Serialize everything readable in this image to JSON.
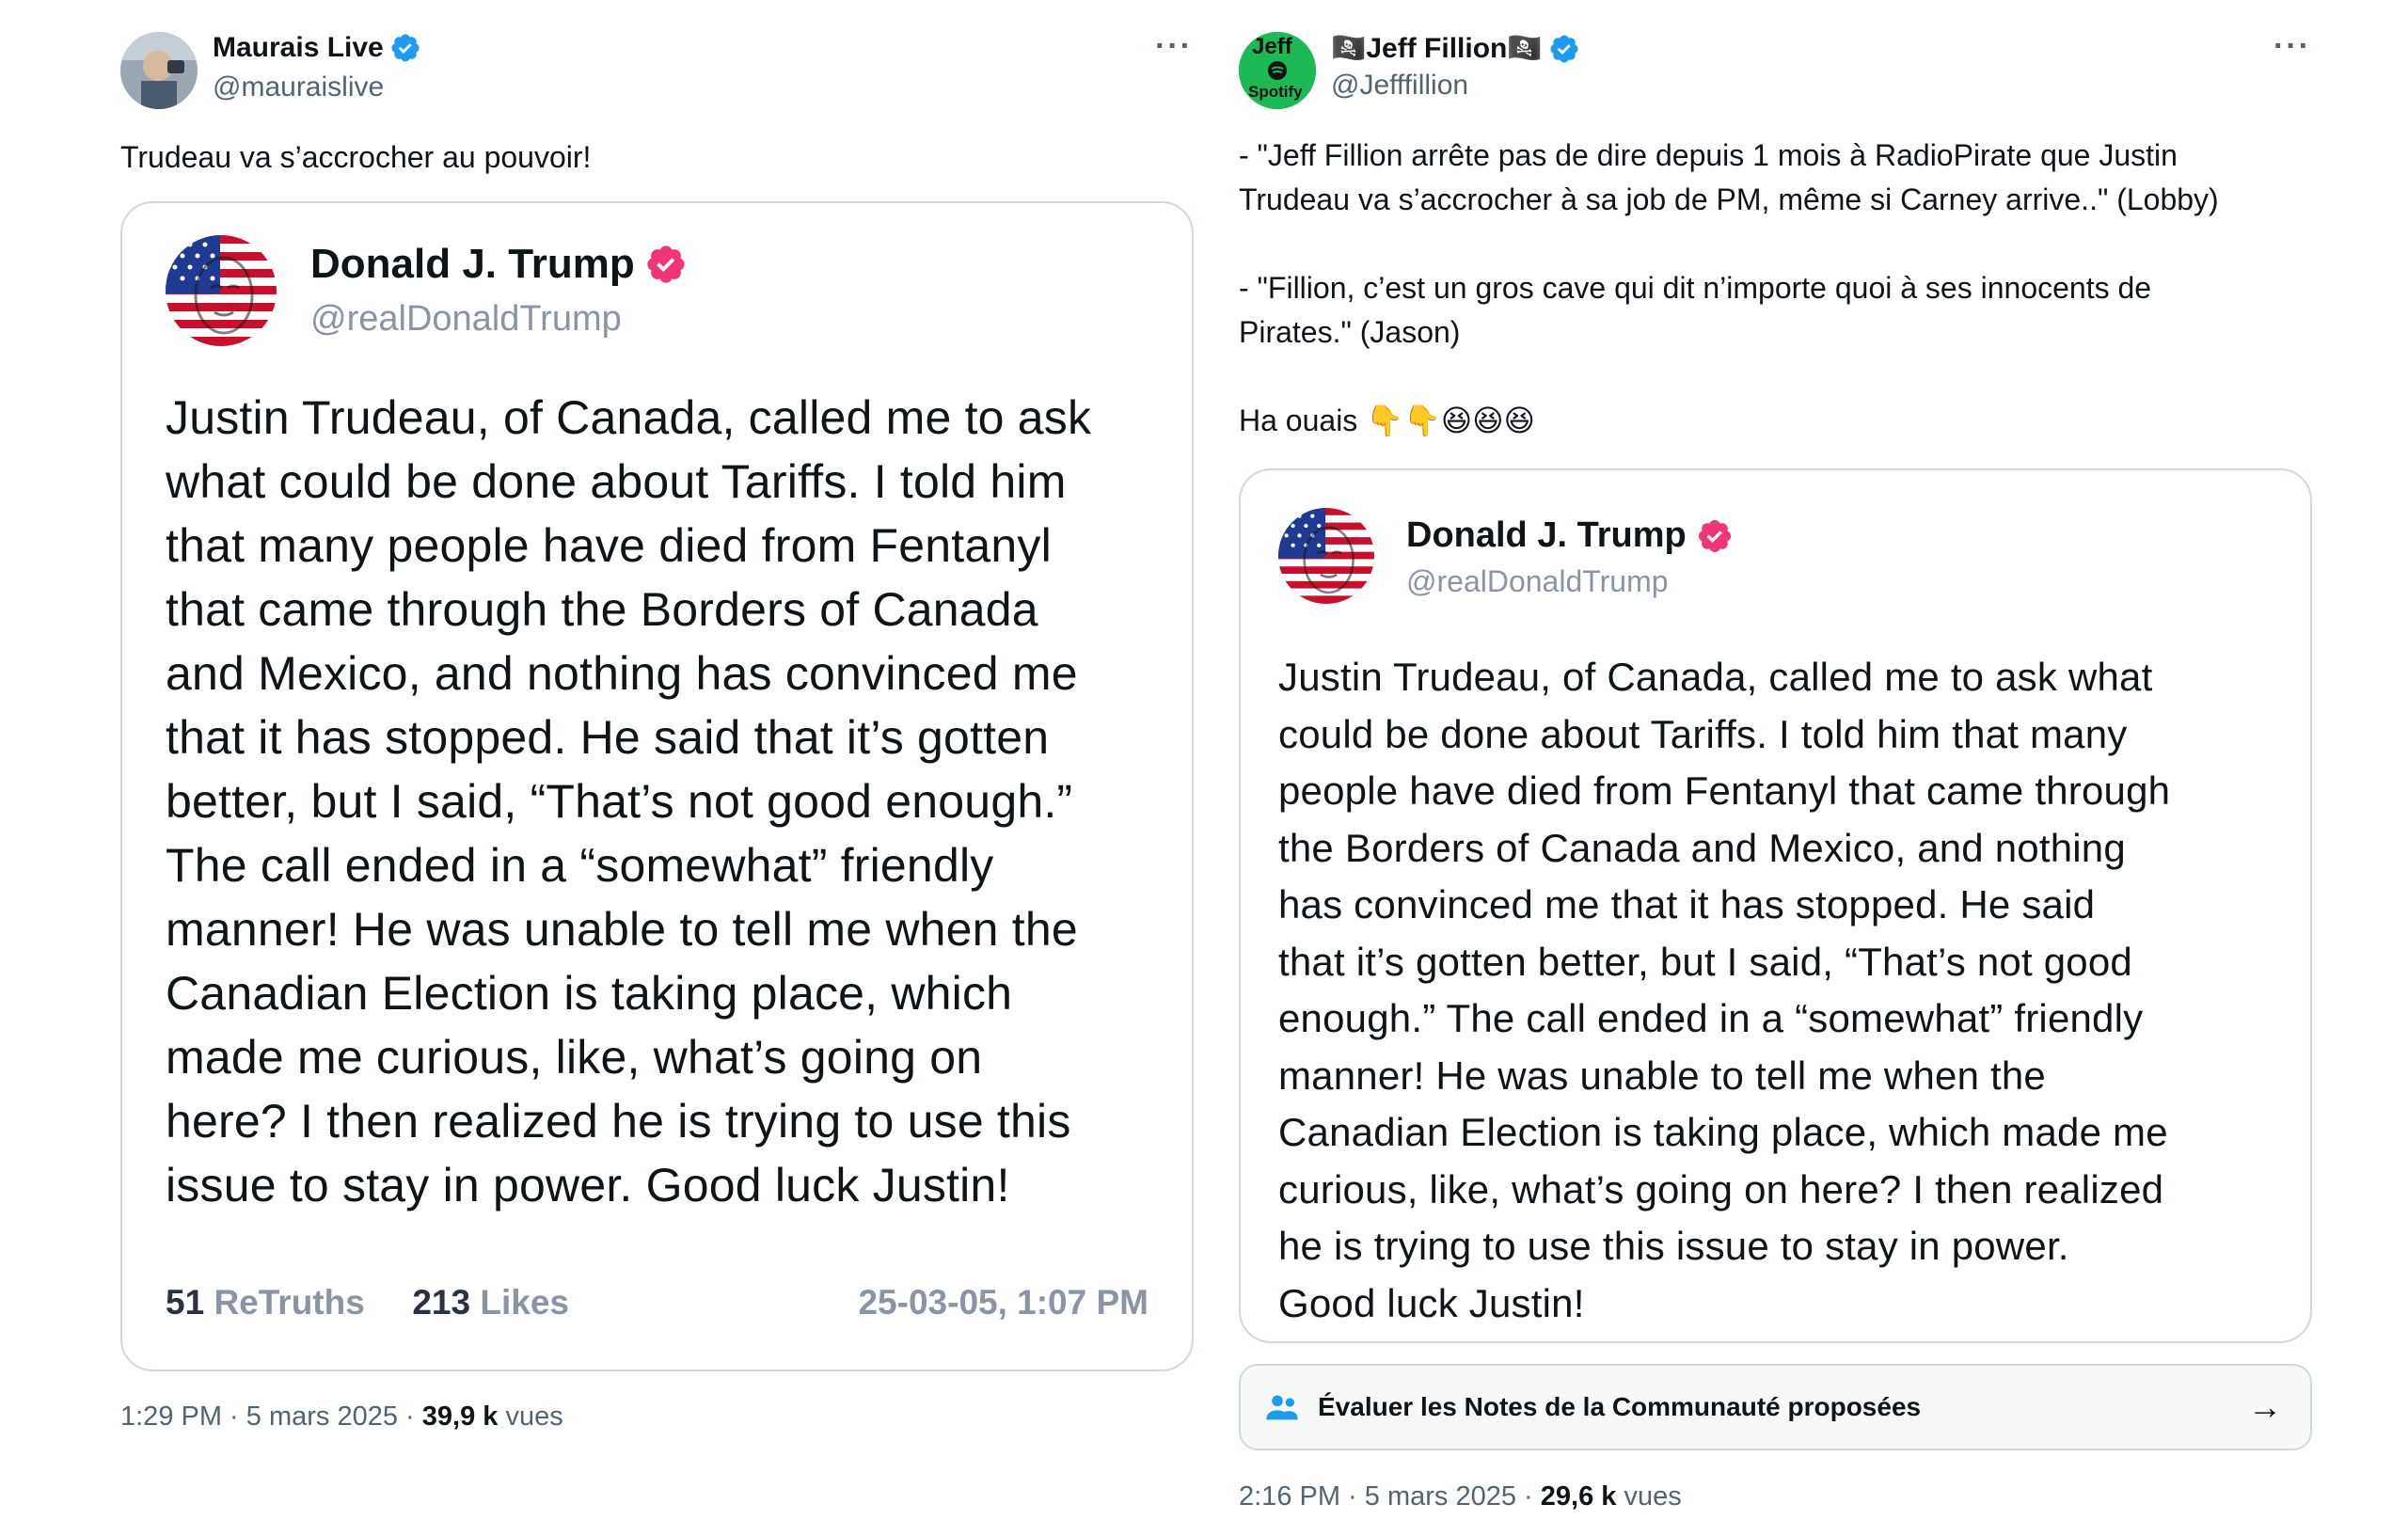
{
  "left": {
    "author": {
      "name": "Maurais Live",
      "handle": "@mauraislive"
    },
    "more": "···",
    "text": "Trudeau va s’accrocher au pouvoir!",
    "quote": {
      "name": "Donald J. Trump",
      "handle": "@realDonaldTrump",
      "body_lines": [
        "Justin Trudeau, of Canada, called me to ask",
        "what could be done about Tariffs. I told him",
        "that many people have died from Fentanyl",
        "that came through the Borders of Canada",
        "and Mexico, and nothing has convinced me",
        "that it has stopped. He said that it’s gotten",
        "better, but I said, “That’s not good enough.”",
        "The call ended in a “somewhat” friendly",
        "manner! He was unable to tell me when the",
        "Canadian Election is taking place, which",
        "made me curious, like, what’s going on",
        "here? I then realized he is trying to use this",
        "issue to stay in power. Good luck Justin!"
      ],
      "retruths_count": "51",
      "retruths_label": "ReTruths",
      "likes_count": "213",
      "likes_label": "Likes",
      "timestamp": "25-03-05, 1:07 PM"
    },
    "meta": {
      "time": "1:29 PM · 5 mars 2025 · ",
      "views_count": "39,9 k",
      "views_label": " vues"
    }
  },
  "right": {
    "author": {
      "name": "🏴‍☠️Jeff Fillion🏴‍☠️",
      "handle": "@Jefffillion",
      "avatar_text": "Jeff",
      "avatar_subtext": "Spotify"
    },
    "more": "···",
    "text_lines": [
      "- \"Jeff Fillion arrête pas de dire depuis 1 mois à RadioPirate que Justin",
      "Trudeau va s’accrocher à sa job de PM, même si Carney arrive..\" (Lobby)",
      "",
      "- \"Fillion, c’est un gros cave qui dit n’importe quoi à ses innocents de",
      "Pirates.\" (Jason)",
      "",
      "Ha ouais 👇👇😆😆😆"
    ],
    "quote": {
      "name": "Donald J. Trump",
      "handle": "@realDonaldTrump",
      "body_lines": [
        "Justin Trudeau, of Canada, called me to ask what",
        "could be done about Tariffs. I told him that many",
        "people have died from Fentanyl that came through",
        "the Borders of Canada and Mexico, and nothing",
        "has convinced me that it has stopped. He said",
        "that it’s gotten better, but I said, “That’s not good",
        "enough.” The call ended in a “somewhat” friendly",
        "manner! He was unable to tell me when the",
        "Canadian Election is taking place, which made me",
        "curious, like, what’s going on here? I then realized",
        "he is trying to use this issue to stay in power.",
        "Good luck Justin!"
      ]
    },
    "community_notes": {
      "label": "Évaluer les Notes de la Communauté proposées",
      "arrow": "→"
    },
    "meta": {
      "time": "2:16 PM · 5 mars 2025 · ",
      "views_count": "29,6 k",
      "views_label": " vues"
    }
  },
  "colors": {
    "verified_blue": "#1d9bf0",
    "verified_pink": "#f0357a",
    "border": "#cfd9de",
    "muted": "#536471"
  }
}
